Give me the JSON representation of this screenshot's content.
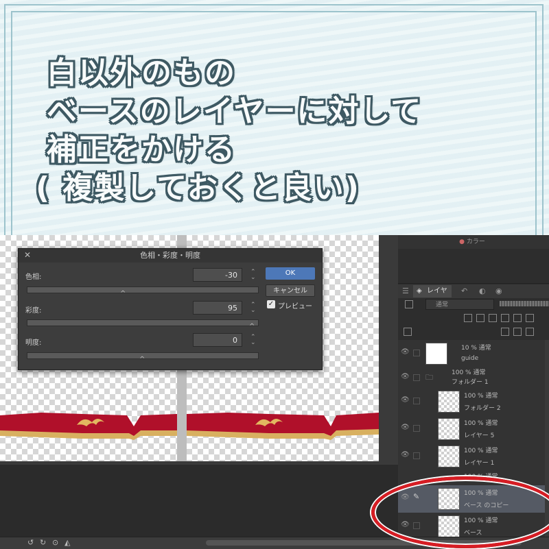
{
  "caption": {
    "line1": "白以外のもの",
    "line2": "ベースのレイヤーに対して",
    "line3": "補正をかける",
    "line4": "( 複製しておくと良い)"
  },
  "dialog": {
    "title": "色相・彩度・明度",
    "hue_label": "色相:",
    "hue_value": "-30",
    "saturation_label": "彩度:",
    "saturation_value": "95",
    "brightness_label": "明度:",
    "brightness_value": "0",
    "ok_label": "OK",
    "cancel_label": "キャンセル",
    "preview_label": "プレビュー",
    "preview_checked": true
  },
  "right_panel": {
    "color_tab": "カラー",
    "layer_tab": "レイヤー",
    "blend_mode": "通常",
    "layers": [
      {
        "mode": "10 % 通常",
        "name": "guide"
      },
      {
        "mode": "100 % 通常",
        "name": "フォルダー 1"
      },
      {
        "mode": "100 % 通常",
        "name": "フォルダー 2"
      },
      {
        "mode": "100 % 通常",
        "name": "レイヤー 5"
      },
      {
        "mode": "100 % 通常",
        "name": "レイヤー 1"
      },
      {
        "mode": "100 % 通常",
        "name": ""
      },
      {
        "mode": "100 % 通常",
        "name": "ベース のコピー"
      },
      {
        "mode": "100 % 通常",
        "name": "ベース"
      }
    ]
  },
  "colors": {
    "highlight_ring": "#d71d24",
    "ok_button": "#4d78b8",
    "ribbon_red": "#b0102a",
    "ribbon_gold": "#d8b060",
    "caption_outline": "#3e5963"
  }
}
